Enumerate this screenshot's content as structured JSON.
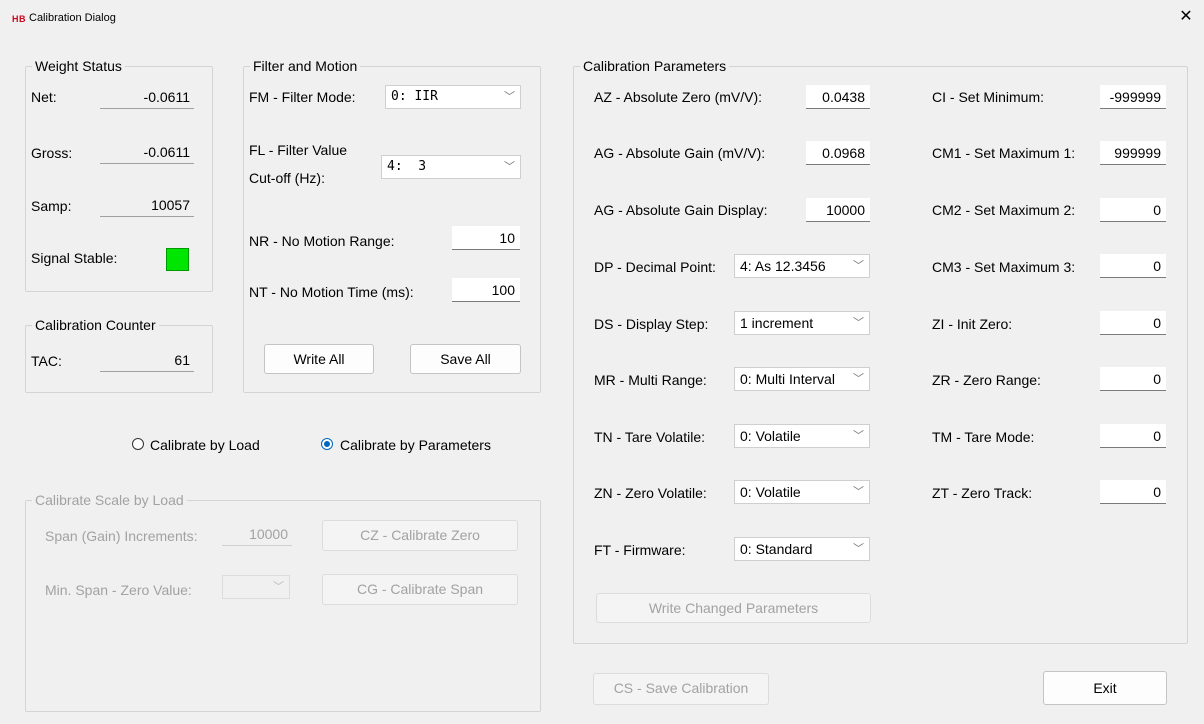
{
  "window": {
    "logo": "HB",
    "title": "Calibration Dialog",
    "close": "✕"
  },
  "weight_status": {
    "legend": "Weight Status",
    "net_label": "Net:",
    "net_value": "-0.0611",
    "gross_label": "Gross:",
    "gross_value": "-0.0611",
    "samp_label": "Samp:",
    "samp_value": "10057",
    "stable_label": "Signal Stable:",
    "stable_color": "#00e600"
  },
  "calibration_counter": {
    "legend": "Calibration Counter",
    "tac_label": "TAC:",
    "tac_value": "61"
  },
  "filter_motion": {
    "legend": "Filter and Motion",
    "fm_label": "FM - Filter Mode:",
    "fm_value": "0: IIR",
    "fl_label_1": "FL - Filter Value",
    "fl_label_2": "Cut-off (Hz):",
    "fl_value": "4:  3",
    "nr_label": "NR - No Motion Range:",
    "nr_value": "10",
    "nt_label": "NT - No Motion Time (ms):",
    "nt_value": "100",
    "write_all": "Write All",
    "save_all": "Save All"
  },
  "calibrate_mode": {
    "by_load": "Calibrate by Load",
    "by_load_checked": false,
    "by_params": "Calibrate by Parameters",
    "by_params_checked": true
  },
  "calibrate_by_load": {
    "legend": "Calibrate Scale by Load",
    "span_label": "Span (Gain) Increments:",
    "span_value": "10000",
    "min_span_label": "Min. Span - Zero Value:",
    "min_span_value": "",
    "cz_button": "CZ - Calibrate Zero",
    "cg_button": "CG - Calibrate Span"
  },
  "calibration_parameters": {
    "legend": "Calibration Parameters",
    "az_label": "AZ - Absolute Zero (mV/V):",
    "az_value": "0.0438",
    "ag_label": "AG - Absolute Gain (mV/V):",
    "ag_value": "0.0968",
    "agd_label": "AG - Absolute Gain Display:",
    "agd_value": "10000",
    "dp_label": "DP - Decimal Point:",
    "dp_value": "4: As 12.3456",
    "ds_label": "DS - Display Step:",
    "ds_value": "1 increment",
    "mr_label": "MR - Multi Range:",
    "mr_value": "0: Multi Interval",
    "tn_label": "TN - Tare Volatile:",
    "tn_value": "0: Volatile",
    "zn_label": "ZN - Zero Volatile:",
    "zn_value": "0: Volatile",
    "ft_label": "FT - Firmware:",
    "ft_value": "0: Standard",
    "ci_label": "CI - Set Minimum:",
    "ci_value": "-999999",
    "cm1_label": "CM1 - Set Maximum 1:",
    "cm1_value": "999999",
    "cm2_label": "CM2 - Set Maximum 2:",
    "cm2_value": "0",
    "cm3_label": "CM3 - Set Maximum 3:",
    "cm3_value": "0",
    "zi_label": "ZI - Init Zero:",
    "zi_value": "0",
    "zr_label": "ZR - Zero Range:",
    "zr_value": "0",
    "tm_label": "TM - Tare Mode:",
    "tm_value": "0",
    "zt_label": "ZT - Zero Track:",
    "zt_value": "0",
    "write_changed": "Write Changed Parameters"
  },
  "footer": {
    "save_calibration": "CS - Save Calibration",
    "exit": "Exit"
  },
  "icons": {
    "dropdown": "chevron-down-icon",
    "close": "close-icon"
  }
}
